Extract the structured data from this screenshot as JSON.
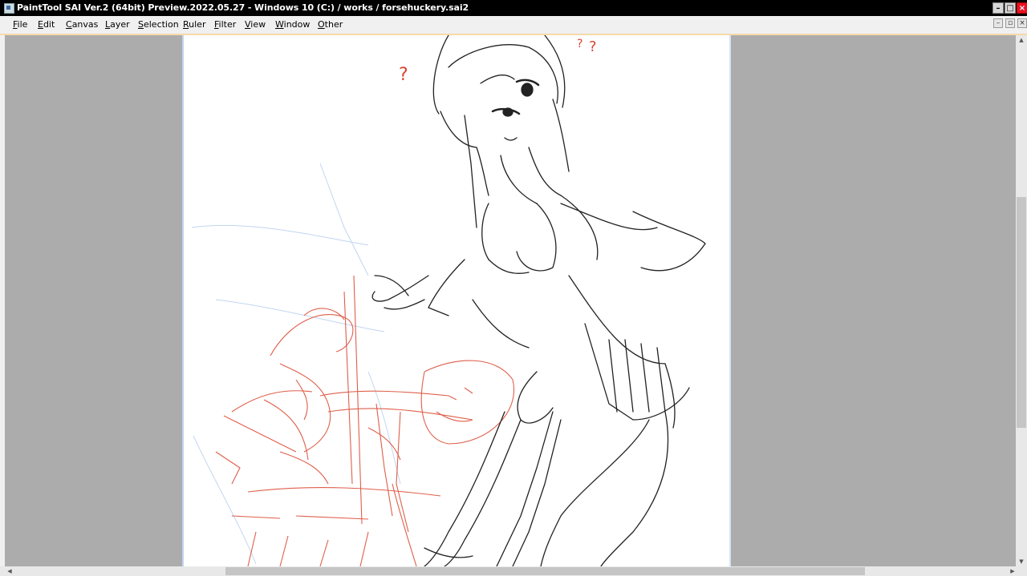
{
  "window": {
    "title": "PaintTool SAI Ver.2 (64bit) Preview.2022.05.27 - Windows 10 (C:) / works / forsehuckery.sai2",
    "minimize_glyph": "–",
    "maximize_glyph": "□",
    "close_glyph": "×"
  },
  "menu": {
    "items": [
      {
        "label": "File"
      },
      {
        "label": "Edit"
      },
      {
        "label": "Canvas"
      },
      {
        "label": "Layer"
      },
      {
        "label": "Selection"
      },
      {
        "label": "Ruler"
      },
      {
        "label": "Filter"
      },
      {
        "label": "View"
      },
      {
        "label": "Window"
      },
      {
        "label": "Other"
      }
    ],
    "mdi_minimize_glyph": "–",
    "mdi_restore_glyph": "▫",
    "mdi_close_glyph": "×"
  },
  "canvas": {
    "sketch_marks": [
      "?",
      "?",
      "?"
    ]
  },
  "scrollbars": {
    "up_glyph": "▲",
    "down_glyph": "▼",
    "left_glyph": "◀",
    "right_glyph": "▶"
  },
  "colors": {
    "title_bar": "#000000",
    "menu_bar": "#f0f0f0",
    "workspace": "#acacac",
    "canvas": "#ffffff",
    "line_art": "#222222",
    "red_sketch": "#d9442c",
    "blue_sketch": "#a9c4e8",
    "close_button": "#e81123"
  }
}
